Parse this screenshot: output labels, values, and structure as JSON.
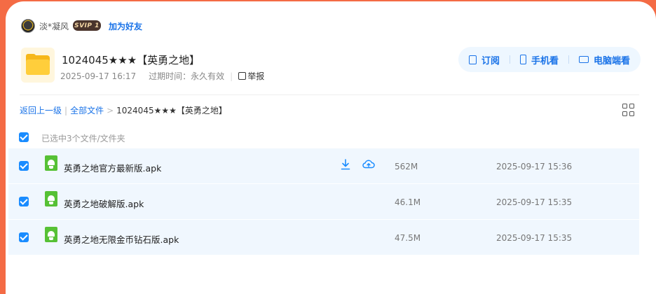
{
  "user": {
    "name": "淡*凝风",
    "vip_badge": "SVIP 1",
    "add_friend_label": "加为好友"
  },
  "folder": {
    "title": "1024045★★★【英勇之地】",
    "created": "2025-09-17 16:17",
    "expiry_label": "过期时间：",
    "expiry_value": "永久有效",
    "report_label": "举报"
  },
  "actions": {
    "subscribe": "订阅",
    "mobile_view": "手机看",
    "pc_view": "电脑端看"
  },
  "breadcrumb": {
    "back": "返回上一级",
    "all_files": "全部文件",
    "separator": ">",
    "current": "1024045★★★【英勇之地】"
  },
  "selection": {
    "summary": "已选中3个文件/文件夹"
  },
  "files": [
    {
      "name": "英勇之地官方最新版.apk",
      "size": "562M",
      "time": "2025-09-17 15:36"
    },
    {
      "name": "英勇之地破解版.apk",
      "size": "46.1M",
      "time": "2025-09-17 15:35"
    },
    {
      "name": "英勇之地无限金币钻石版.apk",
      "size": "47.5M",
      "time": "2025-09-17 15:35"
    }
  ],
  "colors": {
    "background": "#f46b45",
    "accent": "#1a73e8",
    "checkbox": "#1a8cff",
    "row_highlight": "#f0f7fe",
    "apk_icon": "#56c135"
  }
}
